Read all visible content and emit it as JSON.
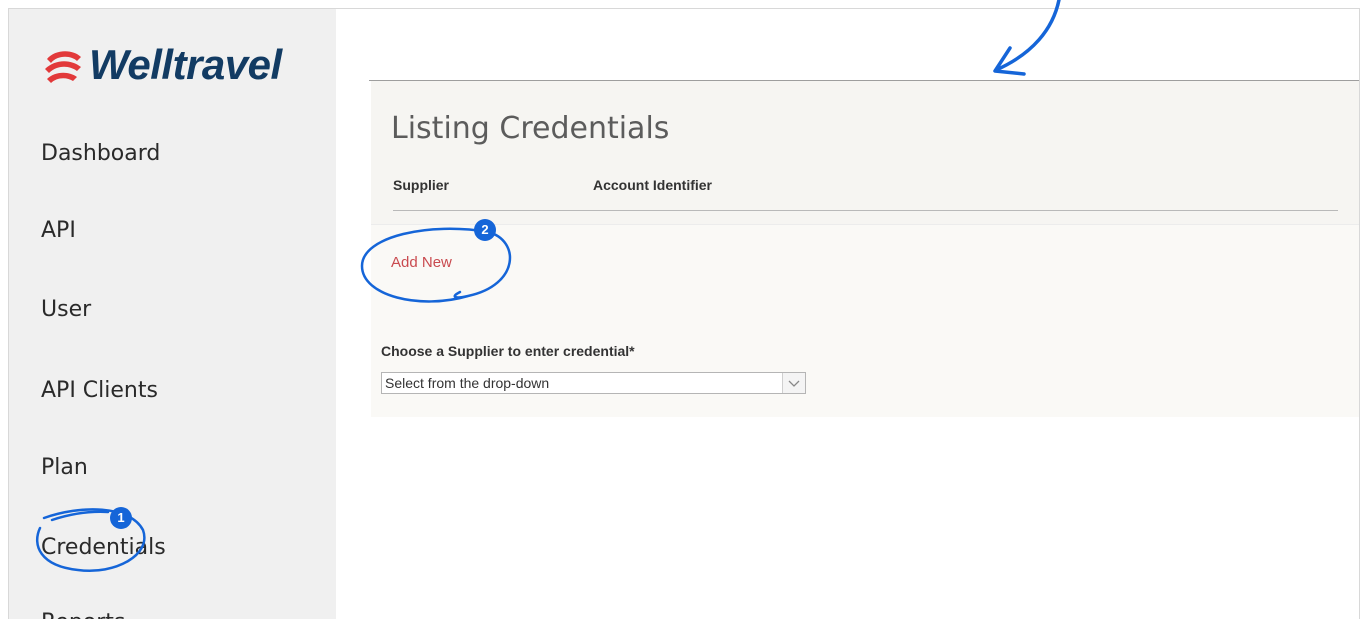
{
  "app": {
    "brand": "Welltravel",
    "brand_color": "#123b63",
    "logo_accent": "#e2393a"
  },
  "sidebar": {
    "items": [
      {
        "label": "Dashboard"
      },
      {
        "label": "API"
      },
      {
        "label": "User"
      },
      {
        "label": "API Clients"
      },
      {
        "label": "Plan"
      },
      {
        "label": "Credentials"
      },
      {
        "label": "Reports"
      }
    ]
  },
  "main": {
    "title": "Listing Credentials",
    "table": {
      "columns": [
        "Supplier",
        "Account Identifier"
      ]
    },
    "add_new_label": "Add New",
    "supplier_field": {
      "label": "Choose a Supplier to enter credential*",
      "value": "Select from the drop-down"
    }
  },
  "annotations": {
    "color": "#1565d8",
    "badges": [
      "1",
      "2"
    ]
  }
}
